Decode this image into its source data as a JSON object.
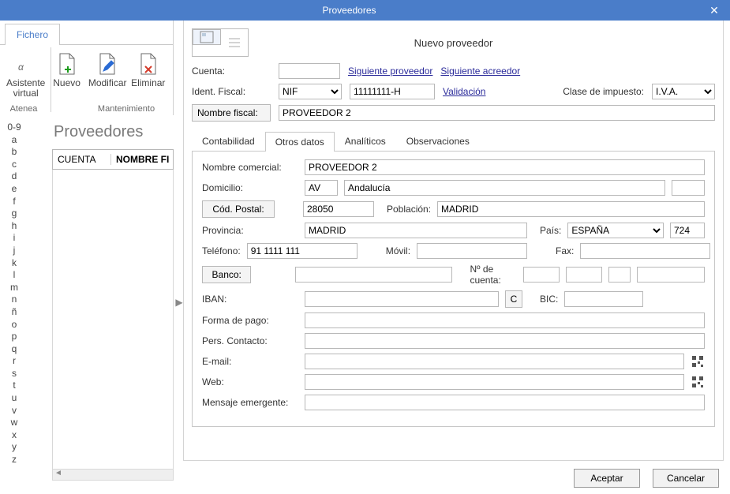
{
  "dialog_title": "Proveedores",
  "ribbon": {
    "tab": "Fichero",
    "assistant": "Asistente virtual",
    "group_left": "Atenea",
    "nuevo": "Nuevo",
    "modificar": "Modificar",
    "eliminar": "Eliminar",
    "group_right": "Mantenimiento"
  },
  "alpha": [
    "0-9",
    "a",
    "b",
    "c",
    "d",
    "e",
    "f",
    "g",
    "h",
    "i",
    "j",
    "k",
    "l",
    "m",
    "n",
    "ñ",
    "o",
    "p",
    "q",
    "r",
    "s",
    "t",
    "u",
    "v",
    "w",
    "x",
    "y",
    "z"
  ],
  "list": {
    "title": "Proveedores",
    "col_cuenta": "CUENTA",
    "col_nombre": "NOMBRE FI"
  },
  "form": {
    "header_title": "Nuevo proveedor",
    "cuenta_label": "Cuenta:",
    "cuenta_value": "",
    "siguiente_proveedor": "Siguiente proveedor",
    "siguiente_acreedor": "Siguiente acreedor",
    "ident_fiscal_label": "Ident. Fiscal:",
    "ident_fiscal_type": "NIF",
    "ident_fiscal_value": "11111111-H",
    "validacion": "Validación",
    "clase_impuesto_label": "Clase de impuesto:",
    "clase_impuesto_value": "I.V.A.",
    "nombre_fiscal_label": "Nombre fiscal:",
    "nombre_fiscal_value": "PROVEEDOR 2"
  },
  "tabs": {
    "contabilidad": "Contabilidad",
    "otros_datos": "Otros datos",
    "analiticos": "Analíticos",
    "observaciones": "Observaciones"
  },
  "otros": {
    "nombre_comercial_label": "Nombre comercial:",
    "nombre_comercial": "PROVEEDOR 2",
    "domicilio_label": "Domicilio:",
    "domicilio_tipo": "AV",
    "domicilio_calle": "Andalucía",
    "domicilio_num": "",
    "cod_postal_btn": "Cód. Postal:",
    "cod_postal": "28050",
    "poblacion_label": "Población:",
    "poblacion": "MADRID",
    "provincia_label": "Provincia:",
    "provincia": "MADRID",
    "pais_label": "País:",
    "pais": "ESPAÑA",
    "pais_code": "724",
    "telefono_label": "Teléfono:",
    "telefono": "91 1111 111",
    "movil_label": "Móvil:",
    "movil": "",
    "fax_label": "Fax:",
    "fax": "",
    "banco_btn": "Banco:",
    "banco": "",
    "num_cuenta_label": "Nº de cuenta:",
    "nc1": "",
    "nc2": "",
    "nc3": "",
    "nc4": "",
    "iban_label": "IBAN:",
    "iban": "",
    "iban_btn": "C",
    "bic_label": "BIC:",
    "bic": "",
    "forma_pago_label": "Forma de pago:",
    "forma_pago": "",
    "pers_contacto_label": "Pers. Contacto:",
    "pers_contacto": "",
    "email_label": "E-mail:",
    "email": "",
    "web_label": "Web:",
    "web": "",
    "mensaje_label": "Mensaje emergente:",
    "mensaje": ""
  },
  "buttons": {
    "accept": "Aceptar",
    "cancel": "Cancelar"
  }
}
